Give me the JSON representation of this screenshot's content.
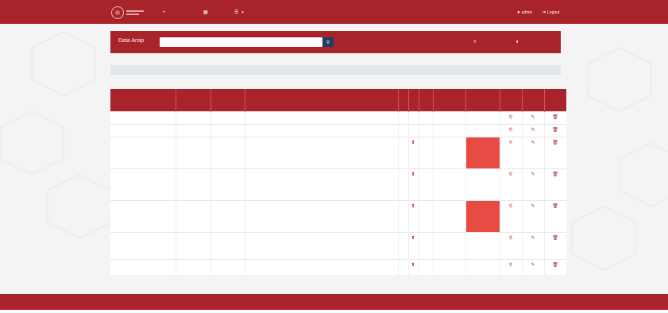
{
  "colors": {
    "brand": "#a8242a",
    "search_button": "#1f3e63",
    "highlight": "#e84b44",
    "info_bg": "#e2e8ea"
  },
  "navbar": {
    "items": [
      {
        "icon": "plus-icon",
        "label": ""
      },
      {
        "icon": "calendar-icon",
        "label": ""
      },
      {
        "icon": "list-icon",
        "label": ""
      }
    ],
    "user": {
      "icon": "user-icon",
      "label": "admin"
    },
    "logout": {
      "icon": "logout-icon",
      "label": "Logout"
    }
  },
  "search": {
    "title": "Data Arsip",
    "placeholder": "",
    "button_icon": "search-icon",
    "links": [
      {
        "icon": "search-icon",
        "label": ""
      },
      {
        "icon": "download-icon",
        "label": ""
      }
    ]
  },
  "info": {
    "text": ""
  },
  "table": {
    "headers": [
      "",
      "",
      "",
      "",
      "",
      "",
      "",
      "",
      "",
      "",
      "",
      ""
    ],
    "rows": [
      {
        "cells": [
          "",
          "",
          "",
          "",
          "",
          "",
          "",
          "",
          ""
        ],
        "highlight": false,
        "has_file": false
      },
      {
        "cells": [
          "",
          "",
          "",
          "",
          "",
          "",
          "",
          "",
          ""
        ],
        "highlight": false,
        "has_file": false
      },
      {
        "cells": [
          "",
          "",
          "",
          "",
          "",
          "",
          "",
          "",
          ""
        ],
        "highlight": true,
        "has_file": true
      },
      {
        "cells": [
          "",
          "",
          "",
          "",
          "",
          "",
          "",
          "",
          ""
        ],
        "highlight": false,
        "has_file": true
      },
      {
        "cells": [
          "",
          "",
          "",
          "",
          "",
          "",
          "",
          "",
          ""
        ],
        "highlight": true,
        "has_file": true
      },
      {
        "cells": [
          "",
          "",
          "",
          "",
          "",
          "",
          "",
          "",
          ""
        ],
        "highlight": false,
        "has_file": true
      },
      {
        "cells": [
          "",
          "",
          "",
          "",
          "",
          "",
          "",
          "",
          ""
        ],
        "highlight": false,
        "has_file": true
      }
    ],
    "action_icons": [
      "search-icon",
      "pencil-icon",
      "trash-icon"
    ]
  },
  "footer": {
    "text": ""
  }
}
